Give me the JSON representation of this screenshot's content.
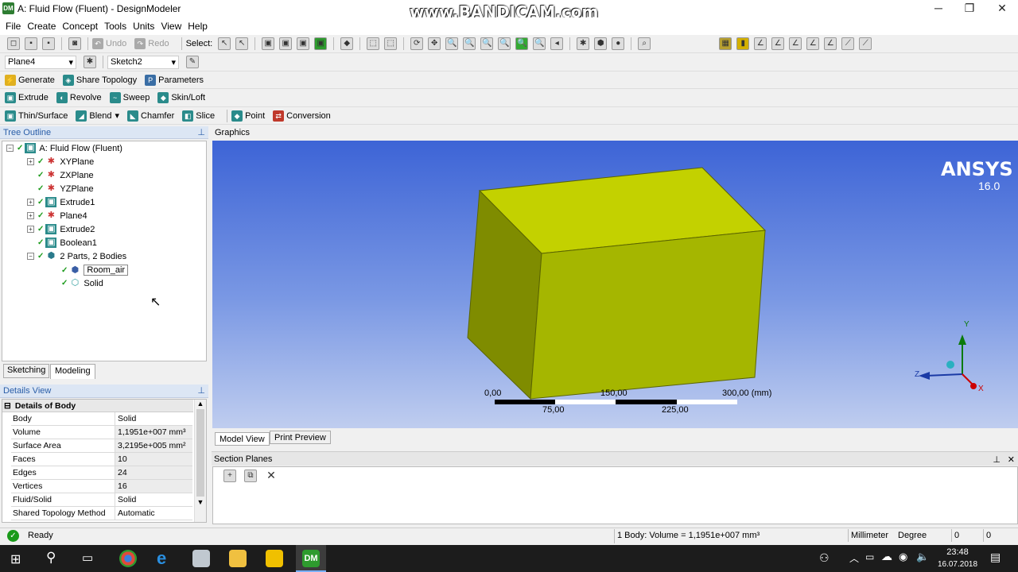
{
  "window": {
    "title": "A: Fluid Flow (Fluent) - DesignModeler",
    "watermark": "www.BANDICAM.com",
    "icon": "DM"
  },
  "menu": [
    "File",
    "Create",
    "Concept",
    "Tools",
    "Units",
    "View",
    "Help"
  ],
  "toolbar1": {
    "undo": "Undo",
    "redo": "Redo",
    "select": "Select:"
  },
  "toolbar2": {
    "plane": "Plane4",
    "sketch": "Sketch2"
  },
  "toolbar3": {
    "generate": "Generate",
    "share_topology": "Share Topology",
    "parameters": "Parameters"
  },
  "toolbar4": {
    "extrude": "Extrude",
    "revolve": "Revolve",
    "sweep": "Sweep",
    "skin_loft": "Skin/Loft"
  },
  "toolbar5": {
    "thin_surface": "Thin/Surface",
    "blend": "Blend",
    "chamfer": "Chamfer",
    "slice": "Slice",
    "point": "Point",
    "conversion": "Conversion"
  },
  "tree": {
    "header": "Tree Outline",
    "root": "A: Fluid Flow (Fluent)",
    "items": [
      "XYPlane",
      "ZXPlane",
      "YZPlane",
      "Extrude1",
      "Plane4",
      "Extrude2",
      "Boolean1",
      "2 Parts, 2 Bodies"
    ],
    "bodies": [
      "Room_air",
      "Solid"
    ],
    "tabs": [
      "Sketching",
      "Modeling"
    ]
  },
  "details": {
    "header": "Details View",
    "group": "Details of Body",
    "rows": [
      {
        "k": "Body",
        "v": "Solid"
      },
      {
        "k": "Volume",
        "v": "1,1951e+007 mm³"
      },
      {
        "k": "Surface Area",
        "v": "3,2195e+005 mm²"
      },
      {
        "k": "Faces",
        "v": "10"
      },
      {
        "k": "Edges",
        "v": "24"
      },
      {
        "k": "Vertices",
        "v": "16"
      },
      {
        "k": "Fluid/Solid",
        "v": "Solid"
      },
      {
        "k": "Shared Topology Method",
        "v": "Automatic"
      }
    ]
  },
  "graphics": {
    "header": "Graphics",
    "brand": "ANSYS",
    "version": "16.0",
    "scale": {
      "top": [
        "0,00",
        "150,00",
        "300,00 (mm)"
      ],
      "bottom": [
        "75,00",
        "225,00"
      ]
    },
    "axes": {
      "x": "X",
      "y": "Y",
      "z": "Z"
    },
    "tabs": [
      "Model View",
      "Print Preview"
    ],
    "colors": {
      "box_front": "#a5b600",
      "box_top": "#c3d100",
      "box_side": "#7f8c00"
    }
  },
  "section_planes": {
    "header": "Section Planes"
  },
  "status": {
    "ready": "Ready",
    "selection": "1 Body: Volume = 1,1951e+007 mm³",
    "units": "Millimeter",
    "angle": "Degree",
    "v1": "0",
    "v2": "0"
  },
  "taskbar": {
    "time": "23:48",
    "date": "16.07.2018"
  }
}
